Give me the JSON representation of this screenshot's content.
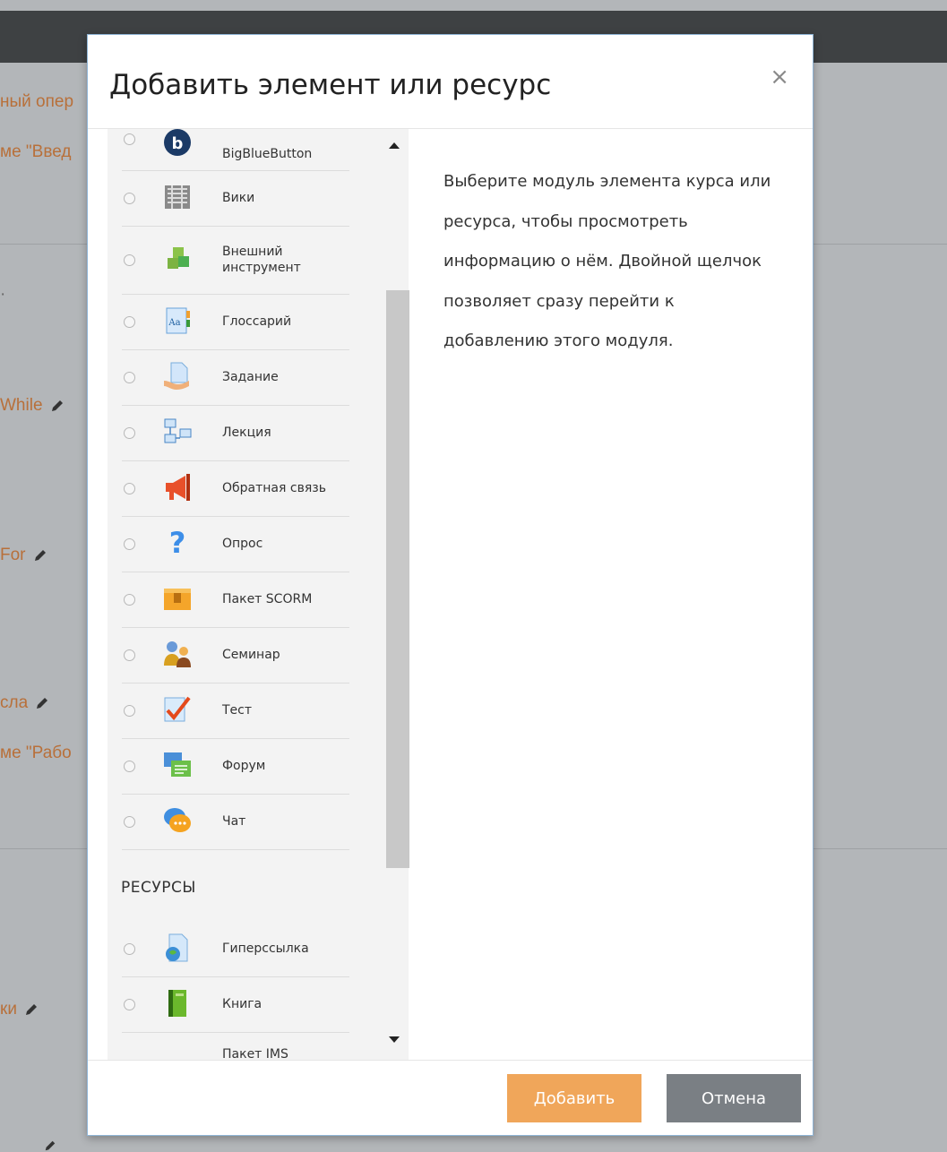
{
  "background": {
    "lines": [
      {
        "text": "ный опер",
        "pencil": false
      },
      {
        "text": "ме \"Введ",
        "pencil": false
      },
      {
        "text": "·",
        "pencil": false
      },
      {
        "text": "While",
        "pencil": true
      },
      {
        "text": "For",
        "pencil": true
      },
      {
        "text": "сла",
        "pencil": true
      },
      {
        "text": "ме \"Рабо",
        "pencil": false
      },
      {
        "text": "ки",
        "pencil": true
      }
    ]
  },
  "modal": {
    "title": "Добавить элемент или ресурс",
    "close_symbol": "×",
    "activities": [
      {
        "label": "BigBlueButton",
        "icon": "bigbluebutton-icon"
      },
      {
        "label": "Вики",
        "icon": "wiki-icon"
      },
      {
        "label": "Внешний инструмент",
        "icon": "external-tool-icon"
      },
      {
        "label": "Глоссарий",
        "icon": "glossary-icon"
      },
      {
        "label": "Задание",
        "icon": "assignment-icon"
      },
      {
        "label": "Лекция",
        "icon": "lesson-icon"
      },
      {
        "label": "Обратная связь",
        "icon": "feedback-icon"
      },
      {
        "label": "Опрос",
        "icon": "choice-icon"
      },
      {
        "label": "Пакет SCORM",
        "icon": "scorm-icon"
      },
      {
        "label": "Семинар",
        "icon": "workshop-icon"
      },
      {
        "label": "Тест",
        "icon": "quiz-icon"
      },
      {
        "label": "Форум",
        "icon": "forum-icon"
      },
      {
        "label": "Чат",
        "icon": "chat-icon"
      }
    ],
    "resources_heading": "РЕСУРСЫ",
    "resources": [
      {
        "label": "Гиперссылка",
        "icon": "url-icon"
      },
      {
        "label": "Книга",
        "icon": "book-icon"
      },
      {
        "label": "Пакет IMS",
        "icon": "ims-package-icon"
      }
    ],
    "description": "Выберите модуль элемента курса или ресурса, чтобы просмотреть информацию о нём. Двойной щелчок позволяет сразу перейти к добавлению этого модуля.",
    "add_label": "Добавить",
    "cancel_label": "Отмена"
  },
  "colors": {
    "add_button": "#f0a65a",
    "cancel_button": "#7a7f84",
    "link_text": "#b8703a"
  }
}
